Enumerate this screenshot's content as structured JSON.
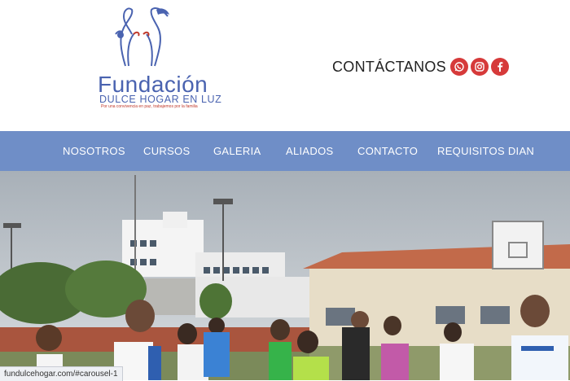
{
  "logo": {
    "title": "Fundación",
    "subtitle": "DULCE HOGAR EN LUZ",
    "tagline": "Por una convivencia en paz, trabajemos por la familia",
    "color": "#4a63b0",
    "accent": "#c0392b"
  },
  "contact": {
    "label": "CONTÁCTANOS",
    "icons": [
      "whatsapp-icon",
      "instagram-icon",
      "facebook-icon"
    ],
    "icon_color": "#d63a3a"
  },
  "nav": {
    "background": "#6f8ec7",
    "items": [
      {
        "label": "NOSOTROS"
      },
      {
        "label": "CURSOS"
      },
      {
        "label": "GALERIA"
      },
      {
        "label": "ALIADOS"
      },
      {
        "label": "CONTACTO"
      },
      {
        "label": "REQUISITOS DIAN"
      }
    ]
  },
  "status_bar": {
    "url": "fundulcehogar.com/#carousel-1"
  }
}
